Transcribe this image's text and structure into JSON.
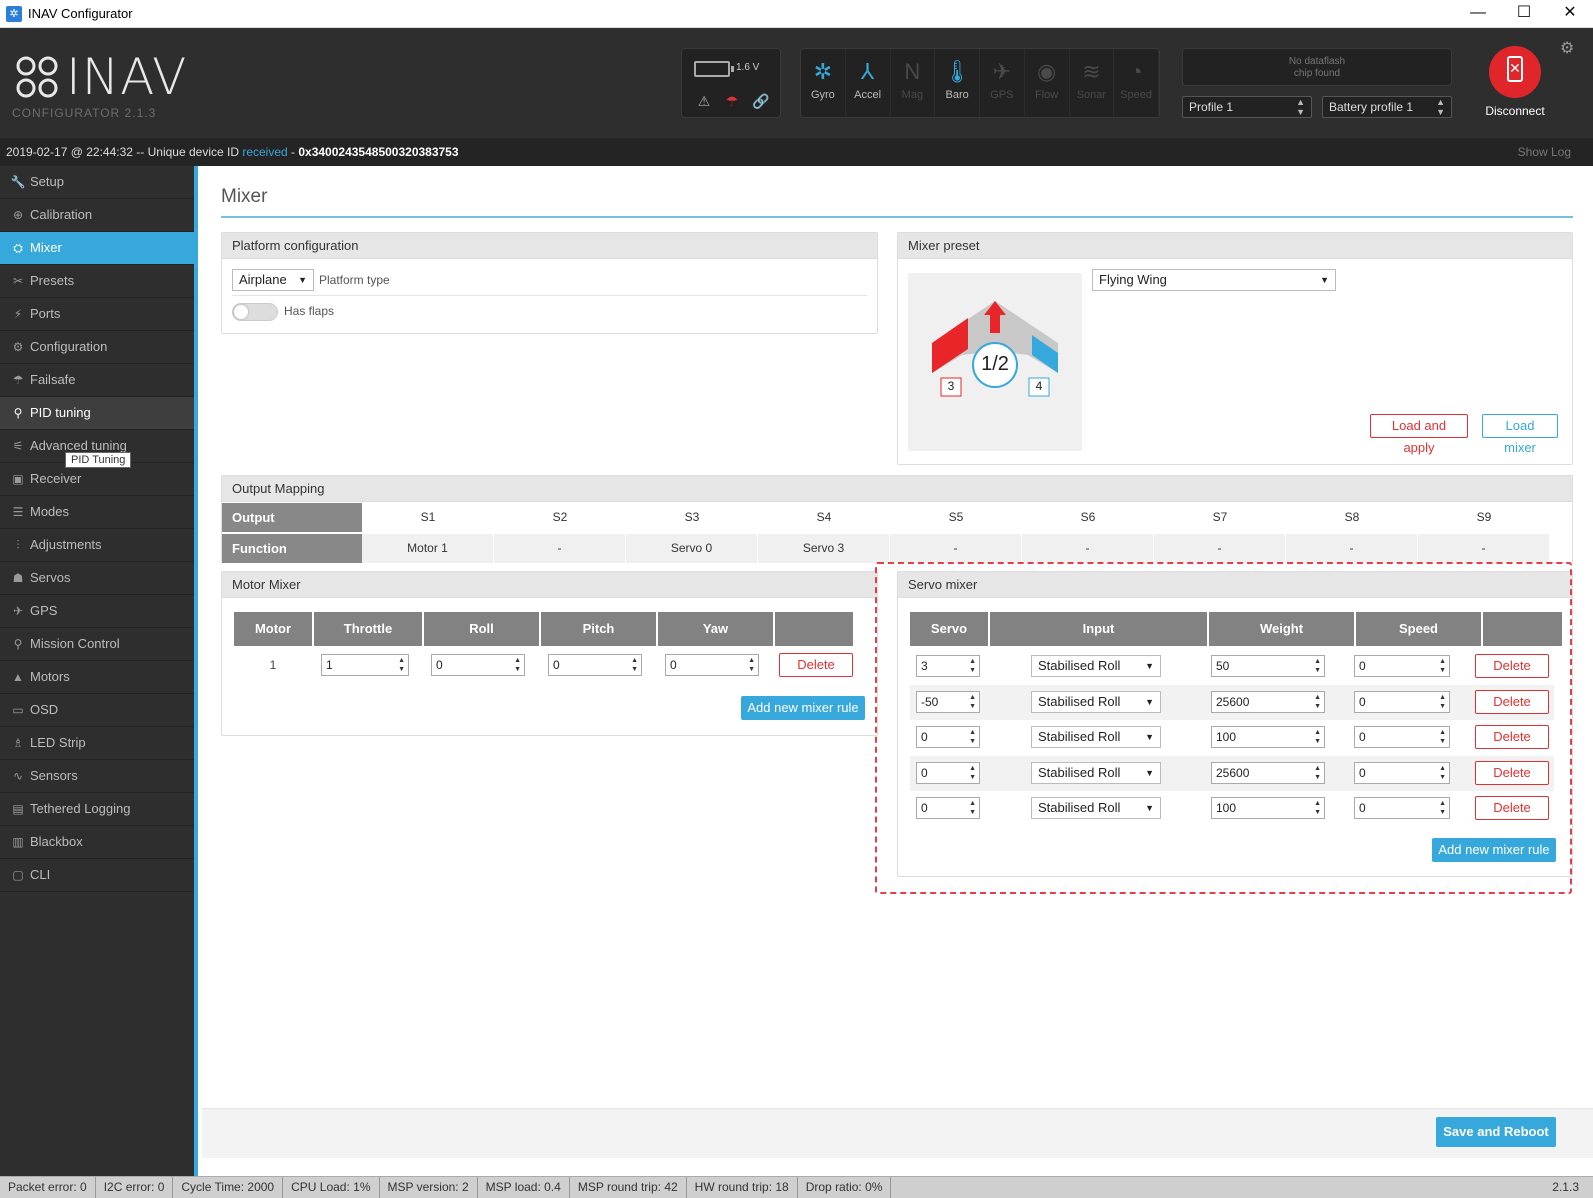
{
  "window": {
    "title": "INAV Configurator",
    "minimize": "—",
    "maximize": "☐",
    "close": "✕"
  },
  "header": {
    "logo_text": "INAV",
    "logo_sub": "CONFIGURATOR   2.1.3",
    "battery_voltage": "1.6 V",
    "sensors": [
      {
        "label": "Gyro",
        "icon": "gyro-icon",
        "glyph": "✲",
        "active": true
      },
      {
        "label": "Accel",
        "icon": "accel-icon",
        "glyph": "⅄",
        "active": true
      },
      {
        "label": "Mag",
        "icon": "mag-icon",
        "glyph": "N",
        "active": false
      },
      {
        "label": "Baro",
        "icon": "baro-icon",
        "glyph": "🌡",
        "active": true
      },
      {
        "label": "GPS",
        "icon": "gps-icon",
        "glyph": "✈",
        "active": false
      },
      {
        "label": "Flow",
        "icon": "flow-icon",
        "glyph": "◉",
        "active": false
      },
      {
        "label": "Sonar",
        "icon": "sonar-icon",
        "glyph": "≋",
        "active": false
      },
      {
        "label": "Speed",
        "icon": "speed-icon",
        "glyph": "◔",
        "active": false
      }
    ],
    "dataflash_line1": "No dataflash",
    "dataflash_line2": "chip found",
    "profile": "Profile 1",
    "battery_profile": "Battery profile 1",
    "disconnect_label": "Disconnect"
  },
  "logbar": {
    "prefix": "2019-02-17 @ 22:44:32 -- Unique device ID ",
    "received": "received",
    "sep": " - ",
    "device_id": "0x3400243548500320383753",
    "show_log": "Show Log"
  },
  "sidebar": {
    "items": [
      {
        "label": "Setup",
        "name": "setup",
        "glyph": "🔧"
      },
      {
        "label": "Calibration",
        "name": "calibration",
        "glyph": "⊕"
      },
      {
        "label": "Mixer",
        "name": "mixer",
        "glyph": "⛭"
      },
      {
        "label": "Presets",
        "name": "presets",
        "glyph": "✂"
      },
      {
        "label": "Ports",
        "name": "ports",
        "glyph": "⚡"
      },
      {
        "label": "Configuration",
        "name": "configuration",
        "glyph": "⚙"
      },
      {
        "label": "Failsafe",
        "name": "failsafe",
        "glyph": "☂"
      },
      {
        "label": "PID tuning",
        "name": "pid-tuning",
        "glyph": "⚲"
      },
      {
        "label": "Advanced tuning",
        "name": "advanced-tuning",
        "glyph": "⚟"
      },
      {
        "label": "Receiver",
        "name": "receiver",
        "glyph": "▣"
      },
      {
        "label": "Modes",
        "name": "modes",
        "glyph": "☰"
      },
      {
        "label": "Adjustments",
        "name": "adjustments",
        "glyph": "⫶"
      },
      {
        "label": "Servos",
        "name": "servos",
        "glyph": "☗"
      },
      {
        "label": "GPS",
        "name": "gps",
        "glyph": "✈"
      },
      {
        "label": "Mission Control",
        "name": "mission-control",
        "glyph": "⚲"
      },
      {
        "label": "Motors",
        "name": "motors",
        "glyph": "▲"
      },
      {
        "label": "OSD",
        "name": "osd",
        "glyph": "▭"
      },
      {
        "label": "LED Strip",
        "name": "led-strip",
        "glyph": "♗"
      },
      {
        "label": "Sensors",
        "name": "sensors",
        "glyph": "∿"
      },
      {
        "label": "Tethered Logging",
        "name": "tethered-logging",
        "glyph": "▤"
      },
      {
        "label": "Blackbox",
        "name": "blackbox",
        "glyph": "▥"
      },
      {
        "label": "CLI",
        "name": "cli",
        "glyph": "▢"
      }
    ],
    "tooltip": "PID Tuning"
  },
  "main": {
    "title": "Mixer",
    "platform": {
      "title": "Platform configuration",
      "platform_value": "Airplane",
      "platform_label": "Platform type",
      "flaps_label": "Has flaps"
    },
    "preset": {
      "title": "Mixer preset",
      "selected": "Flying Wing",
      "diagram_center": "1/2",
      "diagram_left": "3",
      "diagram_right": "4",
      "load_apply": "Load and apply",
      "load_mixer": "Load mixer"
    },
    "output_mapping": {
      "title": "Output Mapping",
      "output_label": "Output",
      "function_label": "Function",
      "outputs": [
        "S1",
        "S2",
        "S3",
        "S4",
        "S5",
        "S6",
        "S7",
        "S8",
        "S9"
      ],
      "functions": [
        "Motor 1",
        "-",
        "Servo 0",
        "Servo 3",
        "-",
        "-",
        "-",
        "-",
        "-"
      ]
    },
    "motor_mixer": {
      "title": "Motor Mixer",
      "headers": [
        "Motor",
        "Throttle",
        "Roll",
        "Pitch",
        "Yaw",
        ""
      ],
      "rows": [
        {
          "motor": "1",
          "throttle": "1",
          "roll": "0",
          "pitch": "0",
          "yaw": "0"
        }
      ],
      "delete_label": "Delete",
      "add_label": "Add new mixer rule"
    },
    "servo_mixer": {
      "title": "Servo mixer",
      "headers": [
        "Servo",
        "Input",
        "Weight",
        "Speed",
        ""
      ],
      "rows": [
        {
          "servo": "3",
          "input": "Stabilised Roll",
          "weight": "50",
          "speed": "0"
        },
        {
          "servo": "-50",
          "input": "Stabilised Roll",
          "weight": "25600",
          "speed": "0"
        },
        {
          "servo": "0",
          "input": "Stabilised Roll",
          "weight": "100",
          "speed": "0"
        },
        {
          "servo": "0",
          "input": "Stabilised Roll",
          "weight": "25600",
          "speed": "0"
        },
        {
          "servo": "0",
          "input": "Stabilised Roll",
          "weight": "100",
          "speed": "0"
        }
      ],
      "delete_label": "Delete",
      "add_label": "Add new mixer rule"
    },
    "save_label": "Save and Reboot"
  },
  "statusbar": {
    "items": [
      "Packet error: 0",
      "I2C error: 0",
      "Cycle Time: 2000",
      "CPU Load: 1%",
      "MSP version: 2",
      "MSP load: 0.4",
      "MSP round trip: 42",
      "HW round trip: 18",
      "Drop ratio: 0%"
    ],
    "version": "2.1.3"
  },
  "colors": {
    "accent": "#37a8db",
    "danger": "#dd3333",
    "header_bg": "#2e2e2e"
  }
}
